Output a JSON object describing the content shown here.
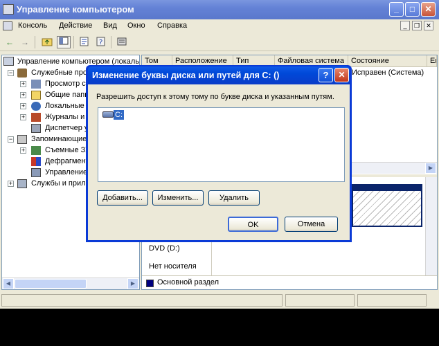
{
  "window": {
    "title": "Управление компьютером"
  },
  "menu": [
    "Консоль",
    "Действие",
    "Вид",
    "Окно",
    "Справка"
  ],
  "tree": {
    "root": "Управление компьютером (локаль",
    "utilities": "Служебные про",
    "event_viewer": "Просмотр со",
    "shared_folders": "Общие папк",
    "local_users": "Локальные",
    "perf_logs": "Журналы и",
    "device_manager": "Диспетчер у",
    "storage": "Запоминающие",
    "removable": "Съемные ЗУ",
    "defrag": "Дефрагмент",
    "disk_mgmt": "Управление",
    "services": "Службы и прило"
  },
  "columns": [
    "Том",
    "Расположение",
    "Тип",
    "Файловая система",
    "Состояние",
    "Ем"
  ],
  "volume_row": {
    "status": "Исправен (Система)"
  },
  "drives": {
    "dvd": "DVD (D:)",
    "no_media": "Нет носителя"
  },
  "legend": {
    "primary": "Основной раздел",
    "primary_color": "#000080"
  },
  "dialog": {
    "title": "Изменение буквы диска или путей для C: ()",
    "description": "Разрешить доступ к этому тому по букве диска и указанным путям.",
    "list_items": [
      "C:"
    ],
    "add": "Добавить...",
    "change": "Изменить...",
    "remove": "Удалить",
    "ok": "OK",
    "cancel": "Отмена",
    "help_glyph": "?",
    "close_glyph": "✕"
  }
}
